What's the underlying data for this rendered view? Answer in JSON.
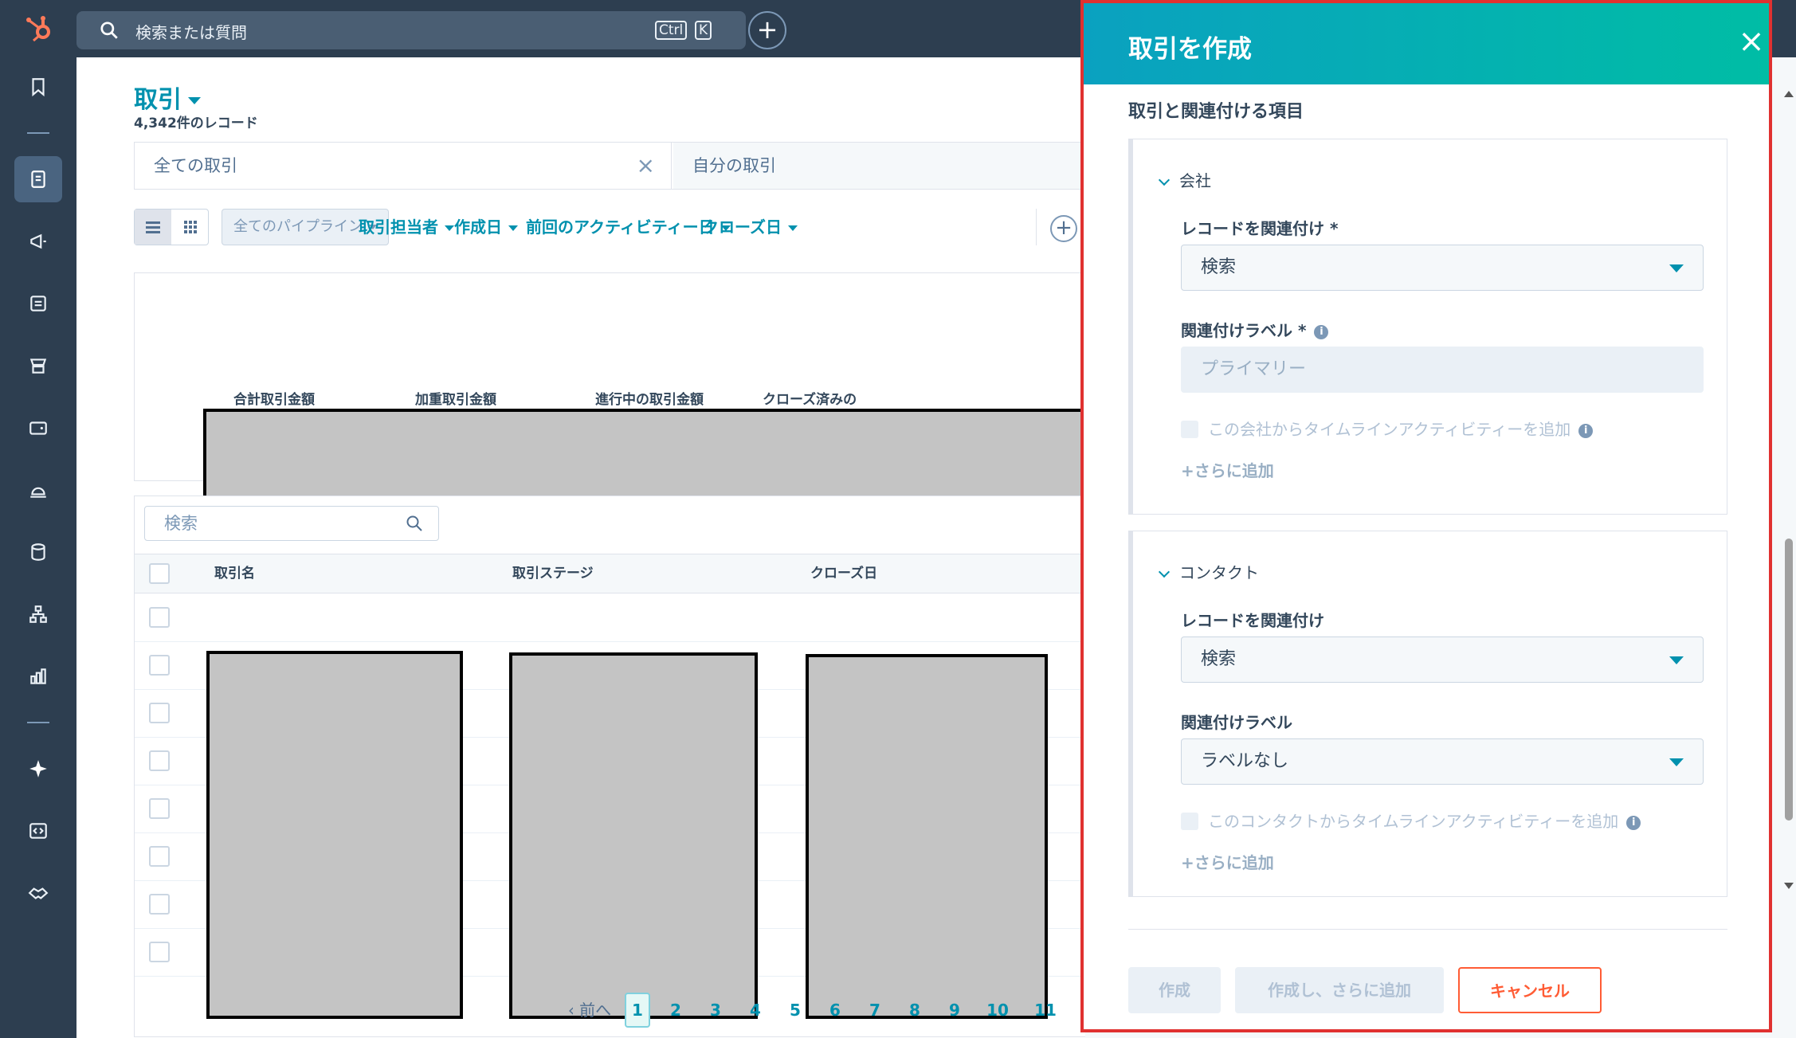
{
  "topbar": {
    "search_placeholder": "検索または質問",
    "kbd_ctrl": "Ctrl",
    "kbd_k": "K",
    "add_symbol": "+"
  },
  "icons": {
    "rail": [
      "bookmark-icon",
      "contacts-icon",
      "megaphone-icon",
      "content-icon",
      "commerce-icon",
      "wallet-icon",
      "service-bell-icon",
      "database-icon",
      "automation-icon",
      "reports-icon",
      "ai-sparkle-icon",
      "dev-code-icon",
      "partner-handshake-icon"
    ]
  },
  "colors": {
    "accent": "#0091ae",
    "rail": "#2d3e50",
    "cancel": "#ff5c35",
    "highlight_border": "#e03130"
  },
  "page": {
    "title": "取引",
    "record_count": "4,342件のレコード",
    "views": [
      {
        "label": "全ての取引"
      },
      {
        "label": "自分の取引"
      }
    ],
    "close_symbol": "×",
    "pipeline_select": "全てのパイプライン",
    "filters": [
      "取引担当者",
      "作成日",
      "前回のアクティビティー日",
      "クローズ日"
    ],
    "add_filter": "+"
  },
  "summary": {
    "labels": [
      "合計取引金額",
      "加重取引金額",
      "進行中の取引金額",
      "クローズ済みの"
    ]
  },
  "table": {
    "search_placeholder": "検索",
    "columns": [
      "取引名",
      "取引ステージ",
      "クローズ日"
    ]
  },
  "pagination": {
    "prev": "前へ",
    "pages": [
      "1",
      "2",
      "3",
      "4",
      "5",
      "6",
      "7",
      "8",
      "9",
      "10",
      "11"
    ],
    "current": "1"
  },
  "panel": {
    "title": "取引を作成",
    "close_symbol": "×",
    "section_title": "取引と関連付ける項目",
    "company": {
      "header": "会社",
      "record_label": "レコードを関連付け *",
      "record_value": "検索",
      "assoc_label": "関連付けラベル *",
      "assoc_value": "プライマリー",
      "timeline_checkbox": "この会社からタイムラインアクティビティーを追加",
      "add_more": "+さらに追加"
    },
    "contact": {
      "header": "コンタクト",
      "record_label": "レコードを関連付け",
      "record_value": "検索",
      "assoc_label": "関連付けラベル",
      "assoc_value": "ラベルなし",
      "timeline_checkbox": "このコンタクトからタイムラインアクティビティーを追加",
      "add_more": "+さらに追加"
    },
    "buttons": {
      "create": "作成",
      "create_add": "作成し、さらに追加",
      "cancel": "キャンセル"
    }
  }
}
